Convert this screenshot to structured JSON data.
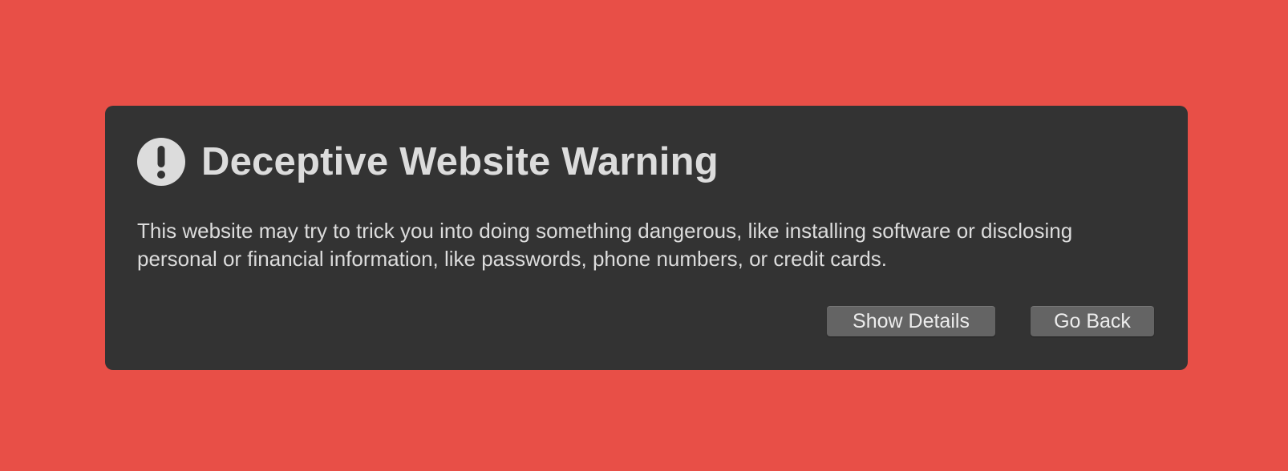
{
  "page": {
    "background_color": "#e84f47",
    "panel_color": "#333333",
    "text_color": "#dcdcdc",
    "button_color": "#646464"
  },
  "warning": {
    "icon": "exclamation-circle-icon",
    "title": "Deceptive Website Warning",
    "message": "This website may try to trick you into doing something dangerous, like installing software or disclosing personal or financial information, like passwords, phone numbers, or credit cards."
  },
  "actions": {
    "show_details_label": "Show Details",
    "go_back_label": "Go Back"
  }
}
